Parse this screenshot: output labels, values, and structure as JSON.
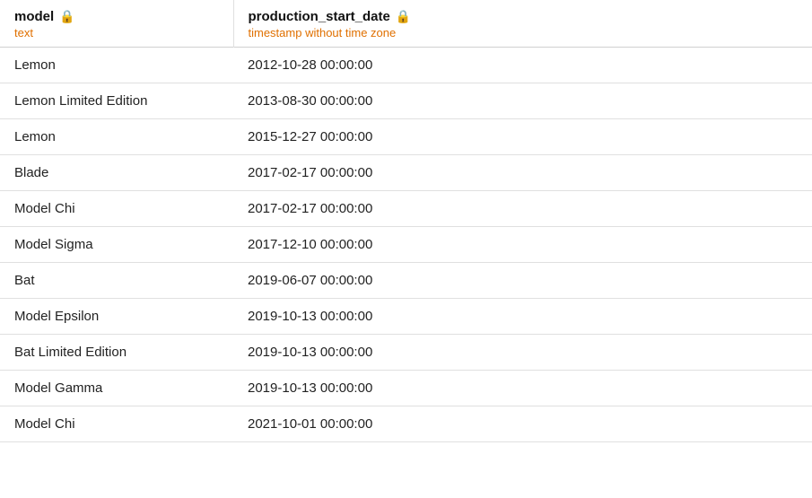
{
  "table": {
    "columns": [
      {
        "id": "model",
        "name": "model",
        "type": "text",
        "locked": true
      },
      {
        "id": "production_start_date",
        "name": "production_start_date",
        "type": "timestamp without time zone",
        "locked": true
      }
    ],
    "rows": [
      {
        "model": "Lemon",
        "production_start_date": "2012-10-28 00:00:00"
      },
      {
        "model": "Lemon Limited Edition",
        "production_start_date": "2013-08-30 00:00:00"
      },
      {
        "model": "Lemon",
        "production_start_date": "2015-12-27 00:00:00"
      },
      {
        "model": "Blade",
        "production_start_date": "2017-02-17 00:00:00"
      },
      {
        "model": "Model Chi",
        "production_start_date": "2017-02-17 00:00:00"
      },
      {
        "model": "Model Sigma",
        "production_start_date": "2017-12-10 00:00:00"
      },
      {
        "model": "Bat",
        "production_start_date": "2019-06-07 00:00:00"
      },
      {
        "model": "Model Epsilon",
        "production_start_date": "2019-10-13 00:00:00"
      },
      {
        "model": "Bat Limited Edition",
        "production_start_date": "2019-10-13 00:00:00"
      },
      {
        "model": "Model Gamma",
        "production_start_date": "2019-10-13 00:00:00"
      },
      {
        "model": "Model Chi",
        "production_start_date": "2021-10-01 00:00:00"
      }
    ],
    "lock_symbol": "🔒"
  }
}
